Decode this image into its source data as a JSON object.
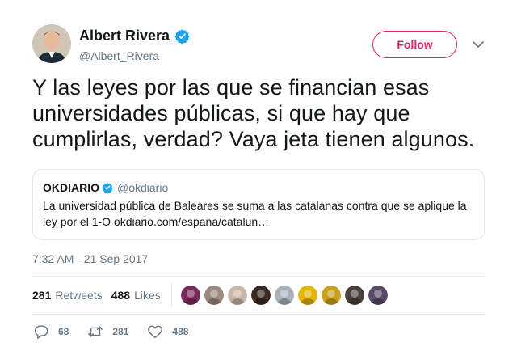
{
  "author": {
    "display_name": "Albert Rivera",
    "handle": "@Albert_Rivera",
    "verified": true,
    "avatar_icon": "profile-photo"
  },
  "follow_button_label": "Follow",
  "tweet_text": "Y las leyes por las que se financian esas universidades públicas, si que hay que cumplirlas, verdad? Vaya jeta tienen algunos.",
  "quoted_tweet": {
    "name": "OKDIARIO",
    "handle": "@okdiario",
    "verified": true,
    "text": "La universidad pública de Baleares se suma a las catalanas contra que se aplique la ley por el 1-O okdiario.com/espana/catalun…"
  },
  "timestamp": "7:32 AM - 21 Sep 2017",
  "stats": {
    "retweets_count": "281",
    "retweets_label": "Retweets",
    "likes_count": "488",
    "likes_label": "Likes"
  },
  "likers": [
    {
      "name": "liker-avatar-1",
      "color": "#7a2a5a"
    },
    {
      "name": "liker-avatar-2",
      "color": "#9a8a80"
    },
    {
      "name": "liker-avatar-3",
      "color": "#c9b8a8"
    },
    {
      "name": "liker-avatar-4",
      "color": "#3a2a22"
    },
    {
      "name": "liker-avatar-5",
      "color": "#a9b2bb"
    },
    {
      "name": "liker-avatar-6",
      "color": "#e4b400"
    },
    {
      "name": "liker-avatar-7",
      "color": "#c8a020"
    },
    {
      "name": "liker-avatar-8",
      "color": "#4a3f3a"
    },
    {
      "name": "liker-avatar-9",
      "color": "#5a4a6a"
    }
  ],
  "actions": {
    "reply_count": "68",
    "retweet_count": "281",
    "like_count": "488"
  },
  "colors": {
    "accent": "#e0245e",
    "verified": "#1da1f2",
    "muted": "#657786",
    "text": "#14171a",
    "border": "#e6ecf0"
  }
}
